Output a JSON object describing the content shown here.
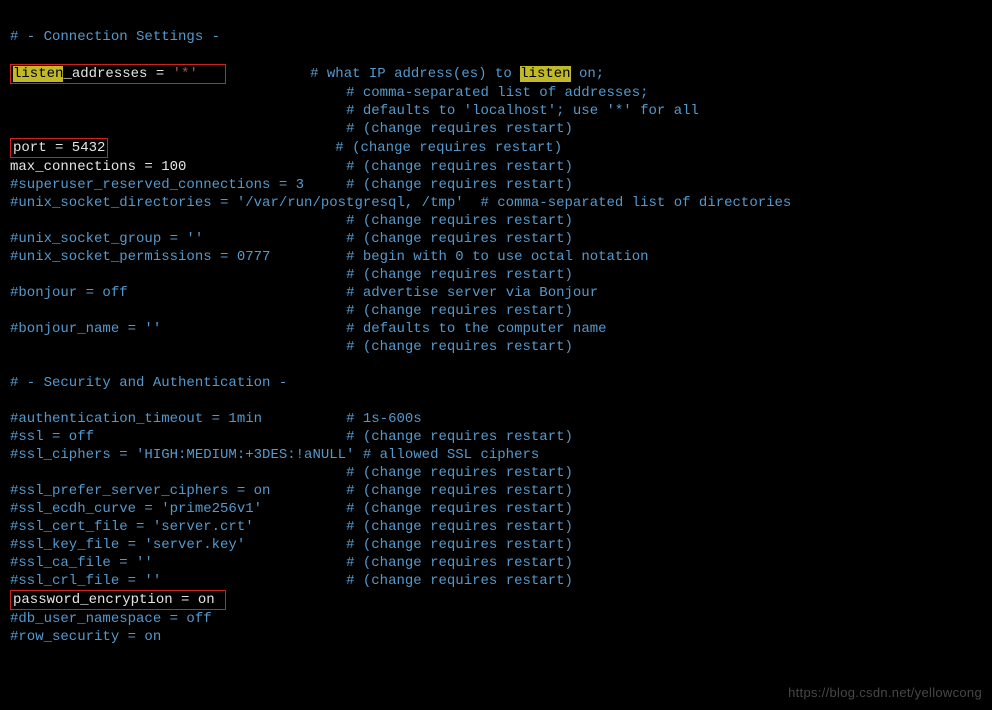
{
  "section1": "# - Connection Settings -",
  "listen": {
    "key_hl": "listen",
    "key_rest": "_addresses = ",
    "val": "'*'",
    "c1_pre": "# what IP address(es) to ",
    "c1_hl": "listen",
    "c1_post": " on;",
    "c2": "# comma-separated list of addresses;",
    "c3": "# defaults to 'localhost'; use '*' for all",
    "c4": "# (change requires restart)"
  },
  "port": {
    "line": "port = 5432",
    "c": "# (change requires restart)"
  },
  "maxconn": {
    "line": "max_connections = 100",
    "c": "# (change requires restart)"
  },
  "su_res": {
    "line": "#superuser_reserved_connections = 3",
    "c": "# (change requires restart)"
  },
  "sockdir": {
    "line": "#unix_socket_directories = '/var/run/postgresql, /tmp'  # comma-separated list of directories",
    "c": "# (change requires restart)"
  },
  "sockgrp": {
    "line": "#unix_socket_group = ''",
    "c": "# (change requires restart)"
  },
  "sockperm": {
    "line": "#unix_socket_permissions = 0777",
    "c1": "# begin with 0 to use octal notation",
    "c2": "# (change requires restart)"
  },
  "bonjour": {
    "line": "#bonjour = off",
    "c1": "# advertise server via Bonjour",
    "c2": "# (change requires restart)"
  },
  "bonjourname": {
    "line": "#bonjour_name = ''",
    "c1": "# defaults to the computer name",
    "c2": "# (change requires restart)"
  },
  "section2": "# - Security and Authentication -",
  "auth_to": {
    "line": "#authentication_timeout = 1min",
    "c": "# 1s-600s"
  },
  "ssl_off": {
    "line": "#ssl = off",
    "c": "# (change requires restart)"
  },
  "ssl_ciph": {
    "line": "#ssl_ciphers = 'HIGH:MEDIUM:+3DES:!aNULL' # allowed SSL ciphers",
    "c": "# (change requires restart)"
  },
  "sslpref": {
    "line": "#ssl_prefer_server_ciphers = on",
    "c": "# (change requires restart)"
  },
  "sslecdh": {
    "line": "#ssl_ecdh_curve = 'prime256v1'",
    "c": "# (change requires restart)"
  },
  "sslcert": {
    "line": "#ssl_cert_file = 'server.crt'",
    "c": "# (change requires restart)"
  },
  "sslkey": {
    "line": "#ssl_key_file = 'server.key'",
    "c": "# (change requires restart)"
  },
  "sslca": {
    "line": "#ssl_ca_file = ''",
    "c": "# (change requires restart)"
  },
  "sslcrl": {
    "line": "#ssl_crl_file = ''",
    "c": "# (change requires restart)"
  },
  "pw_encrypt": "password_encryption = on ",
  "dbuserns": "#db_user_namespace = off",
  "rowsec": "#row_security = on",
  "watermark": "https://blog.csdn.net/yellowcong"
}
